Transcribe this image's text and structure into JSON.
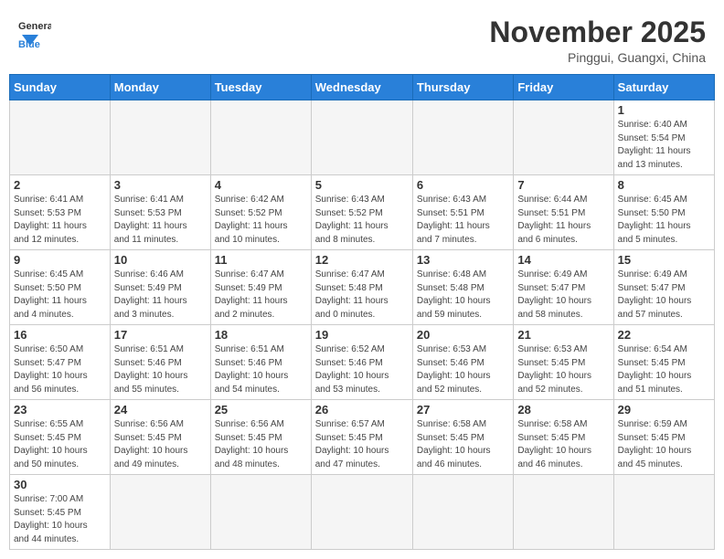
{
  "header": {
    "logo_general": "General",
    "logo_blue": "Blue",
    "month_title": "November 2025",
    "location": "Pinggui, Guangxi, China"
  },
  "weekdays": [
    "Sunday",
    "Monday",
    "Tuesday",
    "Wednesday",
    "Thursday",
    "Friday",
    "Saturday"
  ],
  "days": [
    {
      "num": "",
      "info": ""
    },
    {
      "num": "",
      "info": ""
    },
    {
      "num": "",
      "info": ""
    },
    {
      "num": "",
      "info": ""
    },
    {
      "num": "",
      "info": ""
    },
    {
      "num": "",
      "info": ""
    },
    {
      "num": "1",
      "info": "Sunrise: 6:40 AM\nSunset: 5:54 PM\nDaylight: 11 hours\nand 13 minutes."
    },
    {
      "num": "2",
      "info": "Sunrise: 6:41 AM\nSunset: 5:53 PM\nDaylight: 11 hours\nand 12 minutes."
    },
    {
      "num": "3",
      "info": "Sunrise: 6:41 AM\nSunset: 5:53 PM\nDaylight: 11 hours\nand 11 minutes."
    },
    {
      "num": "4",
      "info": "Sunrise: 6:42 AM\nSunset: 5:52 PM\nDaylight: 11 hours\nand 10 minutes."
    },
    {
      "num": "5",
      "info": "Sunrise: 6:43 AM\nSunset: 5:52 PM\nDaylight: 11 hours\nand 8 minutes."
    },
    {
      "num": "6",
      "info": "Sunrise: 6:43 AM\nSunset: 5:51 PM\nDaylight: 11 hours\nand 7 minutes."
    },
    {
      "num": "7",
      "info": "Sunrise: 6:44 AM\nSunset: 5:51 PM\nDaylight: 11 hours\nand 6 minutes."
    },
    {
      "num": "8",
      "info": "Sunrise: 6:45 AM\nSunset: 5:50 PM\nDaylight: 11 hours\nand 5 minutes."
    },
    {
      "num": "9",
      "info": "Sunrise: 6:45 AM\nSunset: 5:50 PM\nDaylight: 11 hours\nand 4 minutes."
    },
    {
      "num": "10",
      "info": "Sunrise: 6:46 AM\nSunset: 5:49 PM\nDaylight: 11 hours\nand 3 minutes."
    },
    {
      "num": "11",
      "info": "Sunrise: 6:47 AM\nSunset: 5:49 PM\nDaylight: 11 hours\nand 2 minutes."
    },
    {
      "num": "12",
      "info": "Sunrise: 6:47 AM\nSunset: 5:48 PM\nDaylight: 11 hours\nand 0 minutes."
    },
    {
      "num": "13",
      "info": "Sunrise: 6:48 AM\nSunset: 5:48 PM\nDaylight: 10 hours\nand 59 minutes."
    },
    {
      "num": "14",
      "info": "Sunrise: 6:49 AM\nSunset: 5:47 PM\nDaylight: 10 hours\nand 58 minutes."
    },
    {
      "num": "15",
      "info": "Sunrise: 6:49 AM\nSunset: 5:47 PM\nDaylight: 10 hours\nand 57 minutes."
    },
    {
      "num": "16",
      "info": "Sunrise: 6:50 AM\nSunset: 5:47 PM\nDaylight: 10 hours\nand 56 minutes."
    },
    {
      "num": "17",
      "info": "Sunrise: 6:51 AM\nSunset: 5:46 PM\nDaylight: 10 hours\nand 55 minutes."
    },
    {
      "num": "18",
      "info": "Sunrise: 6:51 AM\nSunset: 5:46 PM\nDaylight: 10 hours\nand 54 minutes."
    },
    {
      "num": "19",
      "info": "Sunrise: 6:52 AM\nSunset: 5:46 PM\nDaylight: 10 hours\nand 53 minutes."
    },
    {
      "num": "20",
      "info": "Sunrise: 6:53 AM\nSunset: 5:46 PM\nDaylight: 10 hours\nand 52 minutes."
    },
    {
      "num": "21",
      "info": "Sunrise: 6:53 AM\nSunset: 5:45 PM\nDaylight: 10 hours\nand 52 minutes."
    },
    {
      "num": "22",
      "info": "Sunrise: 6:54 AM\nSunset: 5:45 PM\nDaylight: 10 hours\nand 51 minutes."
    },
    {
      "num": "23",
      "info": "Sunrise: 6:55 AM\nSunset: 5:45 PM\nDaylight: 10 hours\nand 50 minutes."
    },
    {
      "num": "24",
      "info": "Sunrise: 6:56 AM\nSunset: 5:45 PM\nDaylight: 10 hours\nand 49 minutes."
    },
    {
      "num": "25",
      "info": "Sunrise: 6:56 AM\nSunset: 5:45 PM\nDaylight: 10 hours\nand 48 minutes."
    },
    {
      "num": "26",
      "info": "Sunrise: 6:57 AM\nSunset: 5:45 PM\nDaylight: 10 hours\nand 47 minutes."
    },
    {
      "num": "27",
      "info": "Sunrise: 6:58 AM\nSunset: 5:45 PM\nDaylight: 10 hours\nand 46 minutes."
    },
    {
      "num": "28",
      "info": "Sunrise: 6:58 AM\nSunset: 5:45 PM\nDaylight: 10 hours\nand 46 minutes."
    },
    {
      "num": "29",
      "info": "Sunrise: 6:59 AM\nSunset: 5:45 PM\nDaylight: 10 hours\nand 45 minutes."
    },
    {
      "num": "30",
      "info": "Sunrise: 7:00 AM\nSunset: 5:45 PM\nDaylight: 10 hours\nand 44 minutes."
    },
    {
      "num": "",
      "info": ""
    },
    {
      "num": "",
      "info": ""
    },
    {
      "num": "",
      "info": ""
    },
    {
      "num": "",
      "info": ""
    },
    {
      "num": "",
      "info": ""
    },
    {
      "num": "",
      "info": ""
    }
  ]
}
